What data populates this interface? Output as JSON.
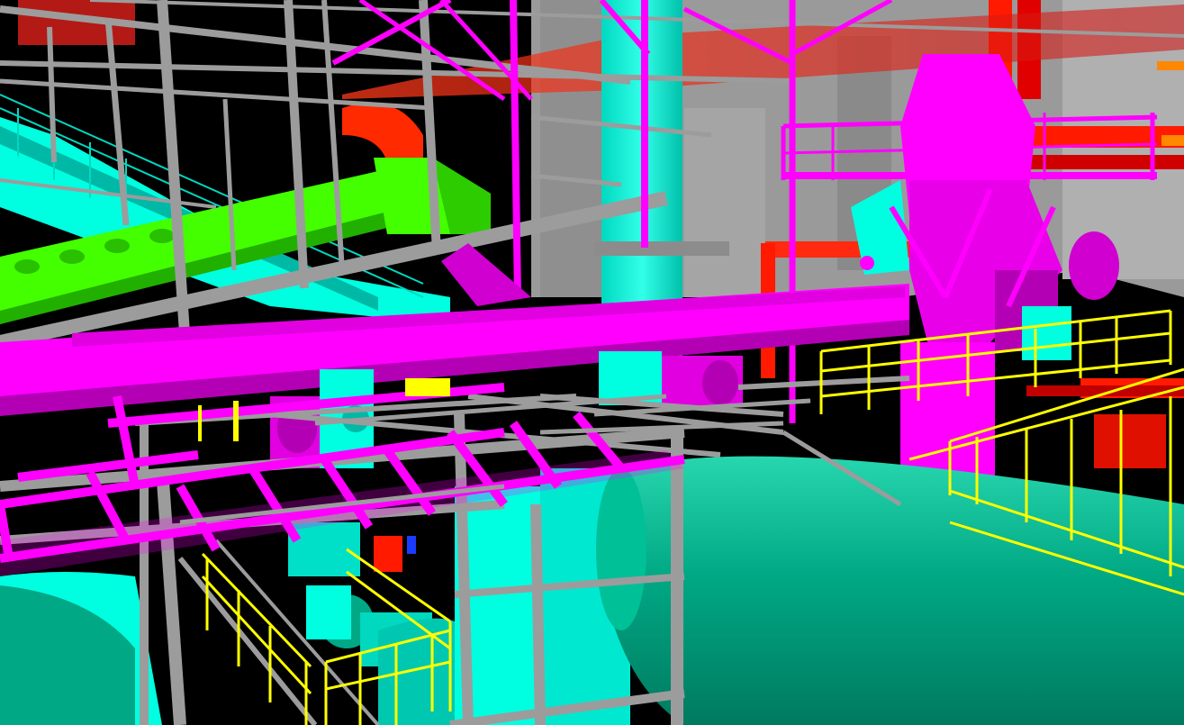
{
  "view": {
    "kind": "3d-plant-model-render",
    "background": "#000000"
  },
  "colors": {
    "steel": "#9c9c9c",
    "steel_dark": "#6e6e6e",
    "magenta": "#ff00ff",
    "magenta_dark": "#b400b4",
    "cyan": "#00ffe0",
    "cyan_dark": "#00b8a6",
    "teal": "#00a886",
    "teal_light": "#18c8a0",
    "green": "#44ff00",
    "green_dark": "#22b000",
    "red": "#ff1a00",
    "red_dark": "#b00000",
    "yellow": "#ffff00",
    "wall": "#a0a0a0",
    "orange": "#ff8800",
    "blue": "#1a3cff"
  }
}
